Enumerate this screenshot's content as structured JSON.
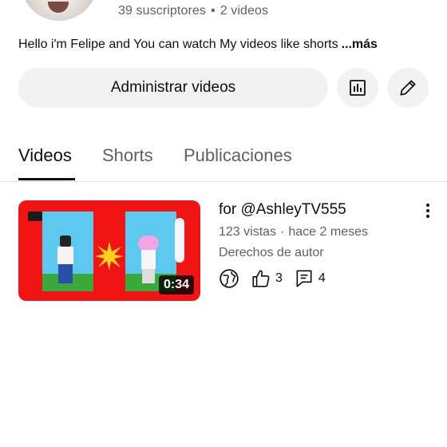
{
  "channel": {
    "subscribers": "39 suscriptores",
    "video_count": "2 videos",
    "description": "Hello i'm Felipe and You can watch My videos like shorts",
    "more_label": "...más"
  },
  "actions": {
    "manage_label": "Administrar videos",
    "stats_icon": "analytics-icon",
    "edit_icon": "pencil-icon"
  },
  "tabs": [
    {
      "label": "Videos",
      "active": true
    },
    {
      "label": "Shorts",
      "active": false
    },
    {
      "label": "Publicaciones",
      "active": false
    }
  ],
  "videos": [
    {
      "title": "for @AshleyTV555",
      "views": "123 vistas",
      "age": "hace 2 meses",
      "rights": "Derechos de autor",
      "duration": "0:34",
      "likes": "3",
      "comments": "4"
    }
  ],
  "colors": {
    "thumb_red": "#f01414",
    "thumb_sky": "#5ec8ee",
    "secondary_text": "#606060",
    "chip_bg": "#f2f2f2"
  }
}
